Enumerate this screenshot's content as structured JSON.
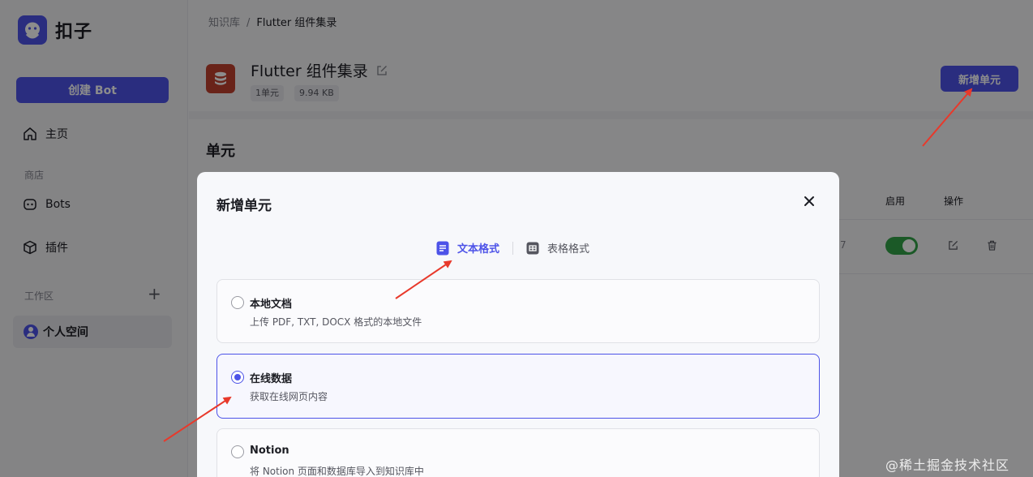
{
  "app": {
    "name": "扣子"
  },
  "sidebar": {
    "create_label": "创建 Bot",
    "home_label": "主页",
    "store_label": "商店",
    "bots_label": "Bots",
    "plugins_label": "插件",
    "workspace_label": "工作区",
    "workspace_add": "+",
    "space_label": "个人空间"
  },
  "breadcrumb": {
    "root": "知识库",
    "sep": "/",
    "current": "Flutter 组件集录"
  },
  "knowledge": {
    "title": "Flutter 组件集录",
    "units_count": "1单元",
    "size": "9.94 KB",
    "add_unit_label": "新增单元"
  },
  "units": {
    "section_title": "单元",
    "col_enabled": "启用",
    "col_actions": "操作",
    "row_partial": "7"
  },
  "modal": {
    "title": "新增单元",
    "tabs": [
      {
        "label": "文本格式",
        "active": true
      },
      {
        "label": "表格格式",
        "active": false
      }
    ],
    "options": [
      {
        "title": "本地文档",
        "desc": "上传 PDF, TXT, DOCX 格式的本地文件",
        "selected": false
      },
      {
        "title": "在线数据",
        "desc": "获取在线网页内容",
        "selected": true
      },
      {
        "title": "Notion",
        "desc": "将 Notion 页面和数据库导入到知识库中",
        "selected": false
      }
    ]
  },
  "watermark": "@稀土掘金技术社区",
  "colors": {
    "accent": "#4d53e8",
    "toggle_on": "#32a247",
    "annotation": "#e8392b"
  }
}
